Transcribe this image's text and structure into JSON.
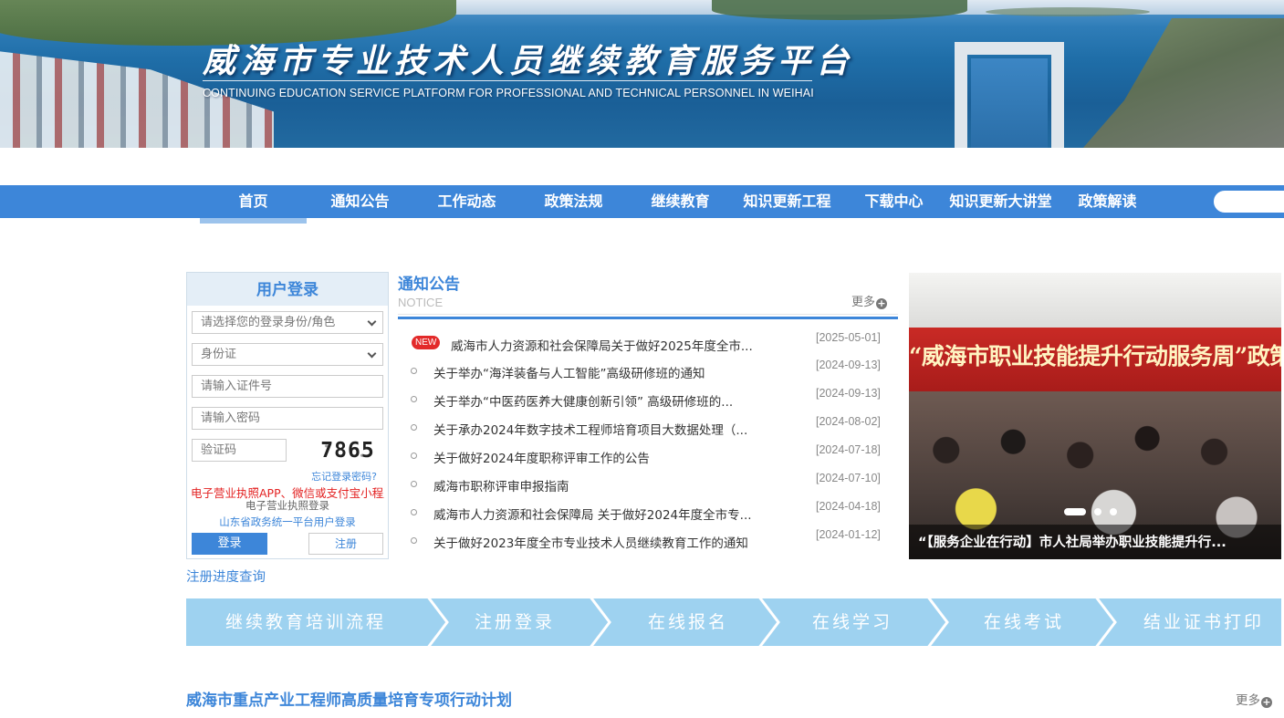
{
  "banner": {
    "title": "威海市专业技术人员继续教育服务平台",
    "subtitle": "CONTINUING EDUCATION SERVICE PLATFORM FOR PROFESSIONAL AND TECHNICAL PERSONNEL IN WEIHAI"
  },
  "nav": {
    "items": [
      "首页",
      "通知公告",
      "工作动态",
      "政策法规",
      "继续教育",
      "知识更新工程",
      "下载中心",
      "知识更新大讲堂",
      "政策解读"
    ],
    "active_index": 0
  },
  "login": {
    "title": "用户登录",
    "role_select": "请选择您的登录身份/角色",
    "id_type_select": "身份证",
    "id_placeholder": "请输入证件号",
    "password_placeholder": "请输入密码",
    "captcha_placeholder": "验证码",
    "captcha_code": "7865",
    "forgot": "忘记登录密码?",
    "ticker": "电子营业执照APP、微信或支付宝小程序扫码登录",
    "biz_license_login": "电子营业执照登录",
    "gov_login": "山东省政务统一平台用户登录",
    "login_button": "登录",
    "register_button": "注册",
    "registration_progress": "注册进度查询"
  },
  "notices": {
    "title": "通知公告",
    "subtitle": "NOTICE",
    "more": "更多",
    "new_badge": "NEW",
    "items": [
      {
        "text": "威海市人力资源和社会保障局关于做好2025年度全市...",
        "date": "[2025-05-01]",
        "is_new": true
      },
      {
        "text": "关于举办“海洋装备与人工智能”高级研修班的通知",
        "date": "[2024-09-13]",
        "is_new": false
      },
      {
        "text": "关于举办“中医药医养大健康创新引领” 高级研修班的...",
        "date": "[2024-09-13]",
        "is_new": false
      },
      {
        "text": "关于承办2024年数字技术工程师培育项目大数据处理（...",
        "date": "[2024-08-02]",
        "is_new": false
      },
      {
        "text": "关于做好2024年度职称评审工作的公告",
        "date": "[2024-07-18]",
        "is_new": false
      },
      {
        "text": "威海市职称评审申报指南",
        "date": "[2024-07-10]",
        "is_new": false
      },
      {
        "text": "威海市人力资源和社会保障局 关于做好2024年度全市专...",
        "date": "[2024-04-18]",
        "is_new": false
      },
      {
        "text": "关于做好2023年度全市专业技术人员继续教育工作的通知",
        "date": "[2024-01-12]",
        "is_new": false
      }
    ]
  },
  "slideshow": {
    "photo_banner_text": "“威海市职业技能提升行动服务周”政策宣讲会",
    "caption": "“【服务企业在行动】市人社局举办职业技能提升行...",
    "active_dot": 0,
    "dot_count": 3
  },
  "process": {
    "steps": [
      "继续教育培训流程",
      "注册登录",
      "在线报名",
      "在线学习",
      "在线考试",
      "结业证书打印"
    ]
  },
  "section": {
    "title": "威海市重点产业工程师高质量培育专项行动计划",
    "more": "更多"
  },
  "colors": {
    "primary": "#3d86d9",
    "process_bar": "#9ed2f0",
    "new_badge": "#e32a2a",
    "ticker": "#e32222"
  }
}
